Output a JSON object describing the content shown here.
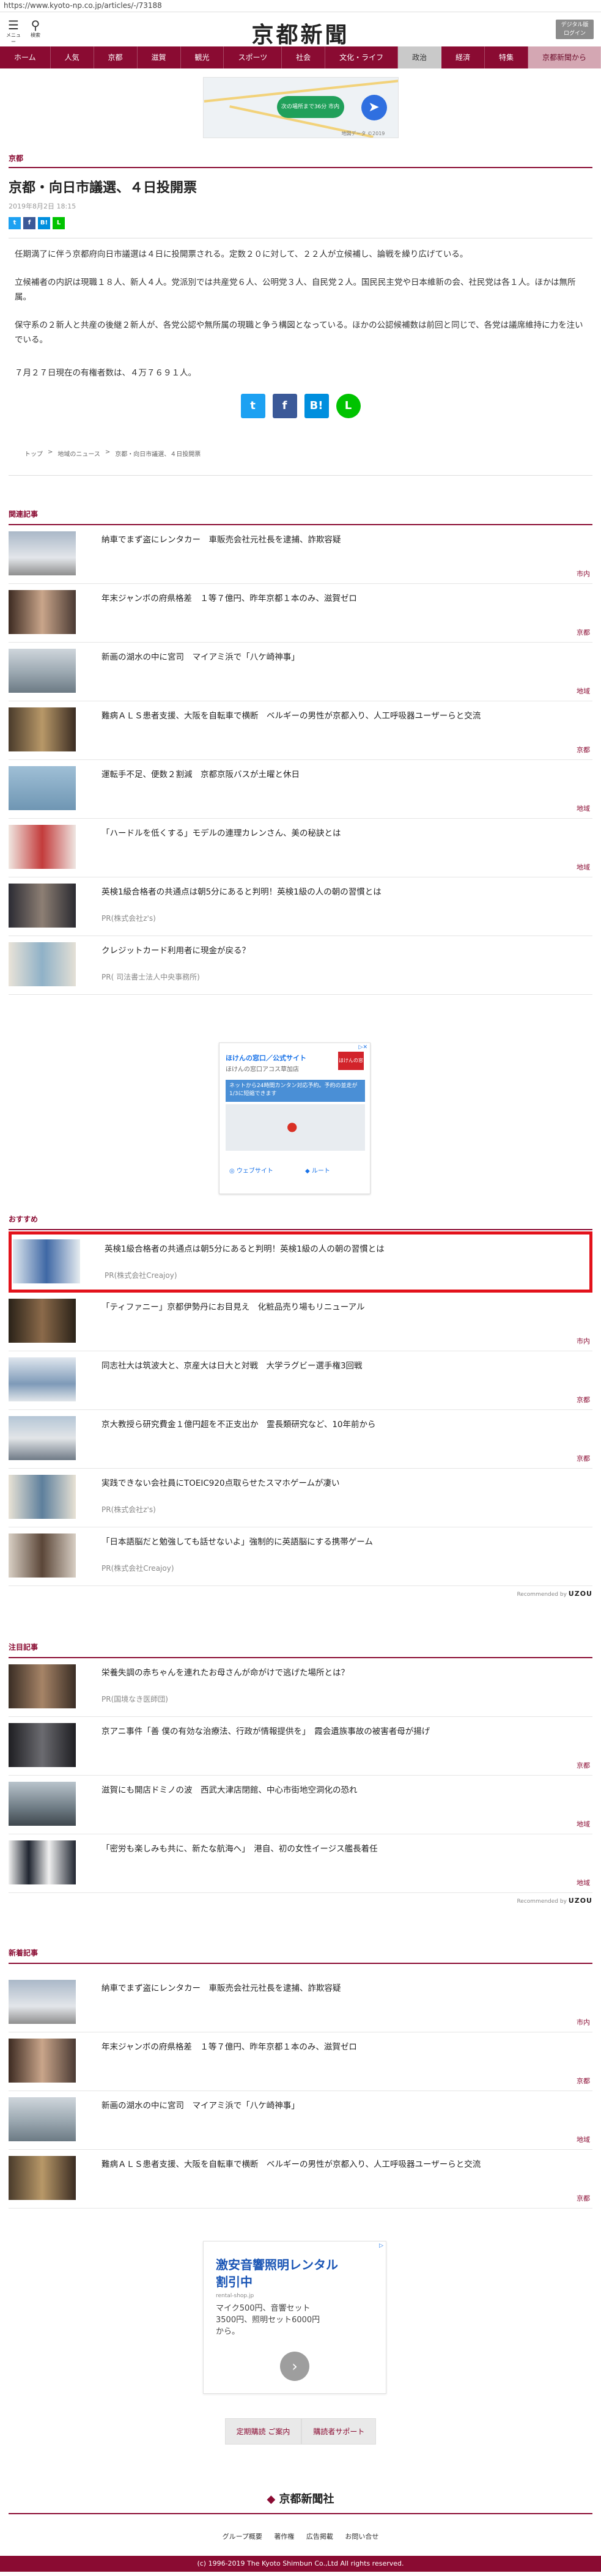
{
  "url": "https://www.kyoto-np.co.jp/articles/-/73188",
  "header": {
    "menu_label": "メニュー",
    "search_label": "検索",
    "logo": "京都新聞",
    "digital_line1": "デジタル版",
    "digital_line2": "ログイン"
  },
  "nav": [
    "ホーム",
    "人気",
    "京都",
    "滋賀",
    "観光",
    "スポーツ",
    "社会",
    "文化・ライフ",
    "政治",
    "経済",
    "特集",
    "京都新聞から"
  ],
  "ad_top": {
    "pill": "次の場所まで36分 市内",
    "note": "地図データ ©2019"
  },
  "article": {
    "section": "京都",
    "title": "京都・向日市議選、４日投開票",
    "date": "2019年8月2日 18:15",
    "paragraphs": [
      "任期満了に伴う京都府向日市議選は４日に投開票される。定数２０に対して、２２人が立候補し、論戦を繰り広げている。",
      "立候補者の内訳は現職１８人、新人４人。党派別では共産党６人、公明党３人、自民党２人。国民民主党や日本維新の会、社民党は各１人。ほかは無所属。",
      "保守系の２新人と共産の後継２新人が、各党公認や無所属の現職と争う構図となっている。ほかの公認候補数は前回と同じで、各党は議席維持に力を注いでいる。",
      "７月２７日現在の有権者数は、４万７６９１人。"
    ]
  },
  "breadcrumb": [
    "トップ",
    "地域のニュース",
    "京都・向日市議選、４日投開票"
  ],
  "related": {
    "heading": "関連記事",
    "items": [
      {
        "title": "納車でまず盗にレンタカー　車販売会社元社長を逮捕、詐欺容疑",
        "cat": "市内"
      },
      {
        "title": "年末ジャンボの府県格差　１等７億円、昨年京都１本のみ、滋賀ゼロ",
        "cat": "京都"
      },
      {
        "title": "新画の湖水の中に宮司　マイアミ浜で「八ケ崎神事」",
        "cat": "地域"
      },
      {
        "title": "難病ＡＬＳ患者支援、大阪を自転車で横断　ベルギーの男性が京都入り、人工呼吸器ユーザーらと交流",
        "cat": "京都"
      },
      {
        "title": "運転手不足、便数２割減　京都京阪バスが土曜と休日",
        "cat": "地域"
      },
      {
        "title": "「ハードルを低くする」モデルの連理カレンさん、美の秘訣とは",
        "cat": "地域"
      },
      {
        "title": "英検1級合格者の共通点は朝5分にあると判明！英検1級の人の朝の習慣とは",
        "pr": "PR(株式会社z's)"
      },
      {
        "title": "クレジットカード利用者に現金が戻る？",
        "pr": "PR( 司法書士法人中央事務所)"
      }
    ]
  },
  "ad_mid": {
    "title": "ほけんの窓口／公式サイト",
    "sub": "ほけんの窓口アコス草加店",
    "badge": "ほけんの窓口",
    "blue_text": "ネットから24時間カンタン対応予約。予約の並走が1/3に短縮できます",
    "btn1": "ウェブサイト",
    "btn2": "ルート"
  },
  "recommend": {
    "heading": "おすすめ",
    "items": [
      {
        "title": "英検1級合格者の共通点は朝5分にあると判明！英検1級の人の朝の習慣とは",
        "pr": "PR(株式会社Creajoy)"
      },
      {
        "title": "「ティファニー」京都伊勢丹にお目見え　化粧品売り場もリニューアル",
        "cat": "市内"
      },
      {
        "title": "同志社大は筑波大と、京産大は日大と対戦　大学ラグビー選手権3回戦",
        "cat": "京都"
      },
      {
        "title": "京大教授ら研究費金１億円超を不正支出か　霊長類研究など、10年前から",
        "cat": "京都"
      },
      {
        "title": "実践できない会社員にTOEIC920点取らせたスマホゲームが凄い",
        "pr": "PR(株式会社z's)"
      },
      {
        "title": "「日本語脳だと勉強しても話せないよ」強制的に英語脳にする携帯ゲーム",
        "pr": "PR(株式会社Creajoy)"
      }
    ],
    "powered": "Recommended by",
    "brand": "UZOU"
  },
  "attention": {
    "heading": "注目記事",
    "items": [
      {
        "title": "栄養失調の赤ちゃんを連れたお母さんが命がけで逃げた場所とは？",
        "pr": "PR(国境なき医師団)"
      },
      {
        "title": "京アニ事件「善 僕の有効な治療法、行政が情報提供を」　霞会遺族事故の被害者母が揚げ",
        "cat": "京都"
      },
      {
        "title": "滋賀にも開店ドミノの波　西武大津店閉館、中心市街地空洞化の恐れ",
        "cat": "地域"
      },
      {
        "title": "「密労も楽しみも共に、新たな航海へ」　港自、初の女性イージス艦長着任",
        "cat": "地域"
      }
    ],
    "powered": "Recommended by",
    "brand": "UZOU"
  },
  "latest": {
    "heading": "新着記事",
    "items": [
      {
        "title": "納車でまず盗にレンタカー　車販売会社元社長を逮捕、詐欺容疑",
        "cat": "市内"
      },
      {
        "title": "年末ジャンボの府県格差　１等７億円、昨年京都１本のみ、滋賀ゼロ",
        "cat": "京都"
      },
      {
        "title": "新画の湖水の中に宮司　マイアミ浜で「八ケ崎神事」",
        "cat": "地域"
      },
      {
        "title": "難病ＡＬＳ患者支援、大阪を自転車で横断　ベルギーの男性が京都入り、人工呼吸器ユーザーらと交流",
        "cat": "京都"
      }
    ]
  },
  "ad_bottom": {
    "line1": "激安音響照明レンタル",
    "line2": "割引中",
    "line3": "マイク500円、音響セット3500円、照明セット6000円から。",
    "small": "rental-shop.jp"
  },
  "footer": {
    "btn1": "定期購読 ご案内",
    "btn2": "購読者サポート",
    "logo": "京都新聞社",
    "links": [
      "グループ概要",
      "著作権",
      "広告掲載",
      "お問い合せ"
    ],
    "copyright": "(c) 1996-2019 The Kyoto Shimbun Co.,Ltd All rights reserved."
  },
  "colors": {
    "brand": "#8a0b32",
    "twitter": "#1da1f2",
    "facebook": "#3b5998",
    "hatena": "#008fde",
    "line": "#00c300",
    "highlight": "#e3121b"
  }
}
